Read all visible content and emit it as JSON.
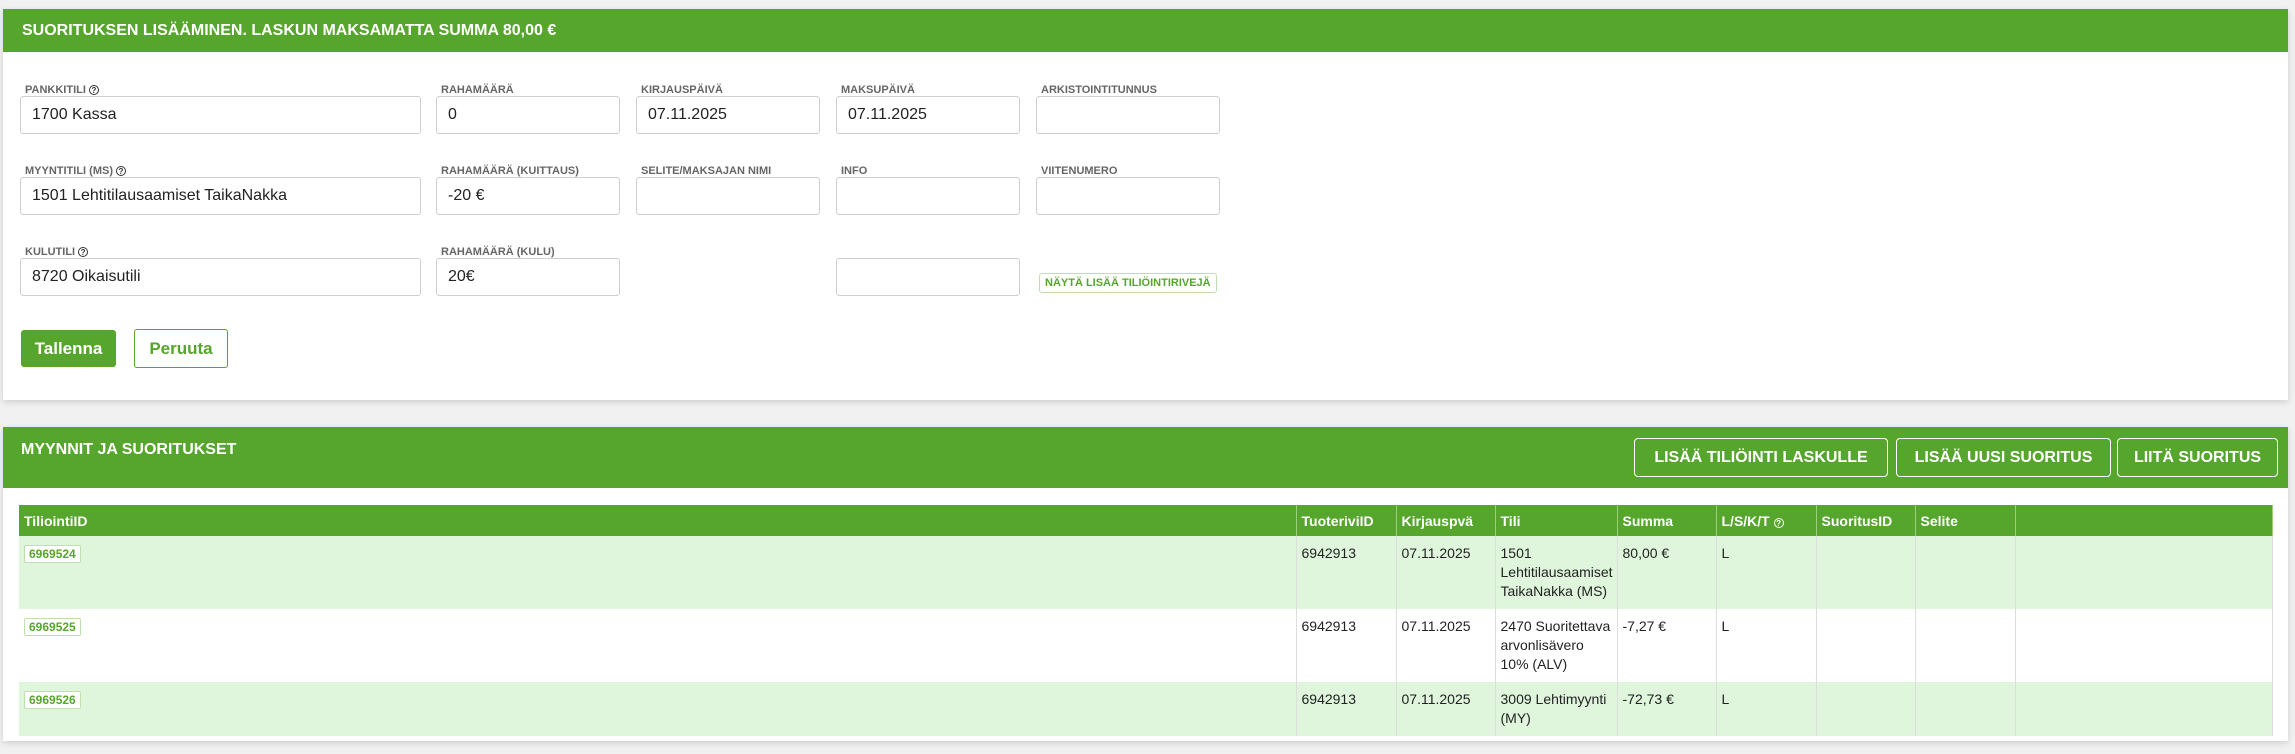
{
  "form": {
    "header": "SUORITUKSEN LISÄÄMINEN. LASKUN MAKSAMATTA SUMMA 80,00 €",
    "bank_account": {
      "label": "PANKKITILI",
      "value": "1700 Kassa"
    },
    "amount": {
      "label": "RAHAMÄÄRÄ",
      "value": "0"
    },
    "posting_date": {
      "label": "KIRJAUSPÄIVÄ",
      "value": "07.11.2025"
    },
    "payment_date": {
      "label": "MAKSUPÄIVÄ",
      "value": "07.11.2025"
    },
    "archive_id": {
      "label": "ARKISTOINTITUNNUS",
      "value": ""
    },
    "sales_account": {
      "label": "MYYNTITILI (MS)",
      "value": "1501 Lehtitilausaamiset TaikaNakka"
    },
    "amount_offset": {
      "label": "RAHAMÄÄRÄ (KUITTAUS)",
      "value": "-20 €"
    },
    "description": {
      "label": "SELITE/MAKSAJAN NIMI",
      "value": ""
    },
    "info": {
      "label": "INFO",
      "value": ""
    },
    "reference": {
      "label": "VIITENUMERO",
      "value": ""
    },
    "expense_account": {
      "label": "KULUTILI",
      "value": "8720 Oikaisutili"
    },
    "amount_expense": {
      "label": "RAHAMÄÄRÄ (KULU)",
      "value": "20€"
    },
    "extra_input": {
      "value": ""
    },
    "show_more_label": "NÄYTÄ LISÄÄ TILIÖINTIRIVEJÄ",
    "save_label": "Tallenna",
    "cancel_label": "Peruuta"
  },
  "ledger": {
    "title": "MYYNNIT JA SUORITUKSET",
    "buttons": {
      "add_posting": "LISÄÄ TILIÖINTI LASKULLE",
      "add_payment": "LISÄÄ UUSI SUORITUS",
      "attach_payment": "LIITÄ SUORITUS"
    },
    "columns": [
      "TiliointiID",
      "TuoteriviID",
      "Kirjauspvä",
      "Tili",
      "Summa",
      "L/S/K/T",
      "SuoritusID",
      "Selite",
      ""
    ],
    "rows": [
      {
        "id": "6969524",
        "product_row": "6942913",
        "date": "07.11.2025",
        "account": "1501 Lehtitilausaamiset TaikaNakka (MS)",
        "amount": "80,00 €",
        "type": "L",
        "payment_id": "",
        "note": ""
      },
      {
        "id": "6969525",
        "product_row": "6942913",
        "date": "07.11.2025",
        "account": "2470 Suoritettava arvonlisävero 10% (ALV)",
        "amount": "-7,27 €",
        "type": "L",
        "payment_id": "",
        "note": ""
      },
      {
        "id": "6969526",
        "product_row": "6942913",
        "date": "07.11.2025",
        "account": "3009 Lehtimyynti (MY)",
        "amount": "-72,73 €",
        "type": "L",
        "payment_id": "",
        "note": ""
      }
    ]
  },
  "icons": {
    "help": "?"
  },
  "colors": {
    "accent": "#56a52c",
    "row_highlight": "#dff6dc"
  }
}
